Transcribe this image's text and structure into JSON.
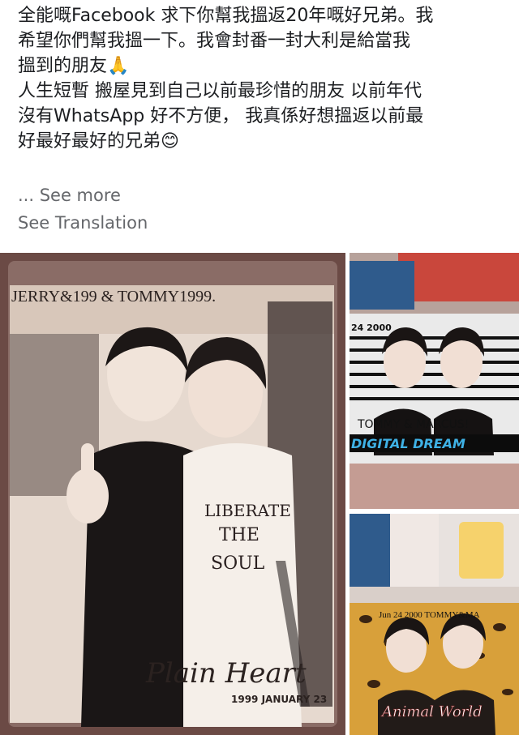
{
  "post": {
    "lines": [
      "全能嘅Facebook 求下你幫我搵返20年嘅好兄弟。我",
      "希望你們幫我搵一下。我會封番一封大利是給當我",
      "搵到的朋友🙏",
      "人生短暫 搬屋見到自己以前最珍惜的朋友 以前年代",
      "沒有WhatsApp 好不方便， 我真係好想搵返以前最",
      "好最好最好的兄弟😊"
    ],
    "see_more": "... See more",
    "see_translation": "See Translation"
  },
  "photos": {
    "main": {
      "header": "JERRY&199 & TOMMY1999.",
      "shirt_text": [
        "LIBERATE",
        "THE",
        "SOUL"
      ],
      "title": "Plain Heart",
      "date": "1999 JANUARY 23"
    },
    "top_right": {
      "date": "24 2000",
      "names": "TOMMY & MARCUS!",
      "title": "DIGITAL DREAM"
    },
    "bottom_right": {
      "header": "Jun 24 2000 TOMMY&MA",
      "title": "Animal World"
    }
  }
}
